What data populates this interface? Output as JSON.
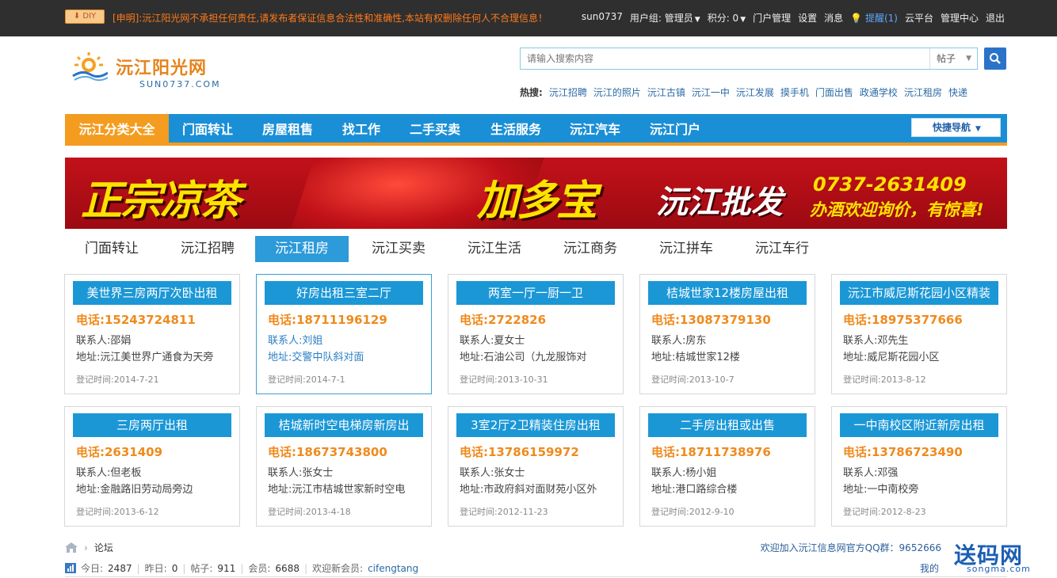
{
  "topbar": {
    "diy_label": "DIY",
    "notice": "[申明]:沅江阳光网不承担任何责任,请发布者保证信息合法性和准确性,本站有权删除任何人不合理信息！",
    "username": "sun0737",
    "usergroup": "用户组: 管理员",
    "points": "积分: 0",
    "links": [
      "门户管理",
      "设置",
      "消息"
    ],
    "remind": "提醒(1)",
    "links2": [
      "云平台",
      "管理中心",
      "退出"
    ]
  },
  "logo": {
    "name": "沅江阳光网",
    "sub": "SUN0737.COM"
  },
  "search": {
    "placeholder": "请输入搜索内容",
    "type": "帖子"
  },
  "hot": {
    "label": "热搜:",
    "items": [
      "沅江招聘",
      "沅江的照片",
      "沅江古镇",
      "沅江一中",
      "沅江发展",
      "摸手机",
      "门面出售",
      "政通学校",
      "沅江租房",
      "快递"
    ]
  },
  "nav": {
    "items": [
      "沅江分类大全",
      "门面转让",
      "房屋租售",
      "找工作",
      "二手买卖",
      "生活服务",
      "沅江汽车",
      "沅江门户"
    ],
    "quick": "快捷导航"
  },
  "banner": {
    "t1": "正宗凉茶",
    "t2": "加多宝",
    "t3": "沅江批发",
    "t4": "0737-2631409",
    "t5": "办酒欢迎询价，有惊喜!"
  },
  "tabs": [
    "门面转让",
    "沅江招聘",
    "沅江租房",
    "沅江买卖",
    "沅江生活",
    "沅江商务",
    "沅江拼车",
    "沅江车行"
  ],
  "cards": [
    {
      "title": "美世界三房两厅次卧出租",
      "phone": "电话:15243724811",
      "contact": "联系人:邵娟",
      "address": "地址:沅江美世界广通食为天旁",
      "date": "登记时间:2014-7-21"
    },
    {
      "title": "好房出租三室二厅",
      "phone": "电话:18711196129",
      "contact": "联系人:刘姐",
      "address": "地址:交警中队斜对面",
      "date": "登记时间:2014-7-1"
    },
    {
      "title": "两室一厅一厨一卫",
      "phone": "电话:2722826",
      "contact": "联系人:夏女士",
      "address": "地址:石油公司（九龙服饰对",
      "date": "登记时间:2013-10-31"
    },
    {
      "title": "桔城世家12楼房屋出租",
      "phone": "电话:13087379130",
      "contact": "联系人:房东",
      "address": "地址:桔城世家12楼",
      "date": "登记时间:2013-10-7"
    },
    {
      "title": "沅江市威尼斯花园小区精装",
      "phone": "电话:18975377666",
      "contact": "联系人:邓先生",
      "address": "地址:威尼斯花园小区",
      "date": "登记时间:2013-8-12"
    },
    {
      "title": "三房两厅出租",
      "phone": "电话:2631409",
      "contact": "联系人:但老板",
      "address": "地址:金融路旧劳动局旁边",
      "date": "登记时间:2013-6-12"
    },
    {
      "title": "桔城新时空电梯房新房出",
      "phone": "电话:18673743800",
      "contact": "联系人:张女士",
      "address": "地址:沅江市桔城世家新时空电",
      "date": "登记时间:2013-4-18"
    },
    {
      "title": "3室2厅2卫精装住房出租",
      "phone": "电话:13786159972",
      "contact": "联系人:张女士",
      "address": "地址:市政府斜对面财苑小区外",
      "date": "登记时间:2012-11-23"
    },
    {
      "title": "二手房出租或出售",
      "phone": "电话:18711738976",
      "contact": "联系人:杨小姐",
      "address": "地址:港口路综合楼",
      "date": "登记时间:2012-9-10"
    },
    {
      "title": "一中南校区附近新房出租",
      "phone": "电话:13786723490",
      "contact": "联系人:邓强",
      "address": "地址:一中南校旁",
      "date": "登记时间:2012-8-23"
    }
  ],
  "crumb": {
    "sep": "›",
    "current": "论坛"
  },
  "qq": "欢迎加入沅江信息网官方QQ群：9652666",
  "stats": {
    "today_label": "今日:",
    "today": "2487",
    "yesterday_label": "昨日:",
    "yesterday": "0",
    "posts_label": "帖子:",
    "posts": "911",
    "members_label": "会员:",
    "members": "6688",
    "newmember_label": "欢迎新会员:",
    "newmember": "cifengtang"
  },
  "mine": "我的",
  "watermark": {
    "big": "送码网",
    "small": "songma.com"
  },
  "colors": {
    "topbar": "#2f2f2f",
    "nav": "#1b8fd6",
    "accent": "#f39c1f",
    "card_title": "#1b97d6",
    "phone": "#f08a1c"
  }
}
